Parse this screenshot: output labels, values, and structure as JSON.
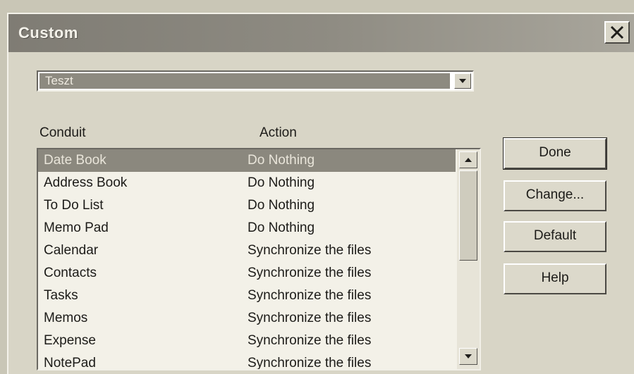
{
  "window": {
    "title": "Custom"
  },
  "icons": {
    "close": "close-x-icon",
    "dropdown": "triangle-down-icon",
    "scroll_up": "triangle-up-icon",
    "scroll_down": "triangle-down-icon"
  },
  "profile_select": {
    "value": "Teszt"
  },
  "columns": {
    "conduit": "Conduit",
    "action": "Action"
  },
  "rows": [
    {
      "conduit": "Date Book",
      "action": "Do Nothing",
      "selected": true
    },
    {
      "conduit": "Address Book",
      "action": "Do Nothing"
    },
    {
      "conduit": "To Do List",
      "action": "Do Nothing"
    },
    {
      "conduit": "Memo Pad",
      "action": "Do Nothing"
    },
    {
      "conduit": "Calendar",
      "action": "Synchronize the files"
    },
    {
      "conduit": "Contacts",
      "action": "Synchronize the files"
    },
    {
      "conduit": "Tasks",
      "action": "Synchronize the files"
    },
    {
      "conduit": "Memos",
      "action": "Synchronize the files"
    },
    {
      "conduit": "Expense",
      "action": "Synchronize the files"
    },
    {
      "conduit": "NotePad",
      "action": "Synchronize the files"
    }
  ],
  "buttons": {
    "done": "Done",
    "change": "Change...",
    "default": "Default",
    "help": "Help"
  }
}
